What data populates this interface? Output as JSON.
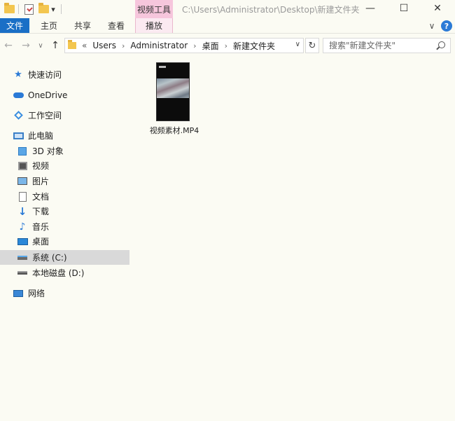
{
  "title_bar": {
    "quick_access": {
      "folder_icon": "folder-icon",
      "properties_icon": "properties-icon",
      "new_folder_icon": "new-folder-icon",
      "dropdown_glyph": "▾"
    },
    "contextual_tab_group": "视频工具",
    "path_title": "C:\\Users\\Administrator\\Desktop\\新建文件夹",
    "window_controls": {
      "minimize": "—",
      "maximize": "☐",
      "close": "✕"
    }
  },
  "ribbon": {
    "tabs": [
      {
        "label": "文件",
        "state": "active"
      },
      {
        "label": "主页"
      },
      {
        "label": "共享"
      },
      {
        "label": "查看"
      },
      {
        "label": "播放"
      }
    ],
    "help_glyph": "?",
    "expand_glyph": "∨"
  },
  "address_bar": {
    "back_glyph": "←",
    "forward_glyph": "→",
    "recent_glyph": "∨",
    "up_glyph": "↑",
    "overflow": "«",
    "breadcrumbs": [
      "Users",
      "Administrator",
      "桌面",
      "新建文件夹"
    ],
    "separator": "›",
    "dropdown_glyph": "∨",
    "refresh_glyph": "↻",
    "search_placeholder": "搜索\"新建文件夹\""
  },
  "nav_pane": {
    "items": [
      {
        "label": "快速访问",
        "icon": "star-icon"
      },
      {
        "label": "OneDrive",
        "icon": "cloud-icon"
      },
      {
        "label": "工作空间",
        "icon": "workspace-icon"
      },
      {
        "label": "此电脑",
        "icon": "computer-icon"
      },
      {
        "label": "3D 对象",
        "icon": "cube-icon"
      },
      {
        "label": "视频",
        "icon": "video-icon"
      },
      {
        "label": "图片",
        "icon": "picture-icon"
      },
      {
        "label": "文档",
        "icon": "document-icon"
      },
      {
        "label": "下载",
        "icon": "download-icon"
      },
      {
        "label": "音乐",
        "icon": "music-icon"
      },
      {
        "label": "桌面",
        "icon": "desktop-icon"
      },
      {
        "label": "系统 (C:)",
        "icon": "drive-icon",
        "selected": true
      },
      {
        "label": "本地磁盘 (D:)",
        "icon": "drive-icon"
      },
      {
        "label": "网络",
        "icon": "network-icon"
      }
    ]
  },
  "content": {
    "files": [
      {
        "name": "视频素材.MP4",
        "icon": "video-thumbnail"
      }
    ]
  },
  "colors": {
    "window_background": "#fbfbf3",
    "file_tab": "#1a6fc6",
    "video_tools_tab": "#f6c6dc",
    "selection": "#d9d9d9"
  }
}
